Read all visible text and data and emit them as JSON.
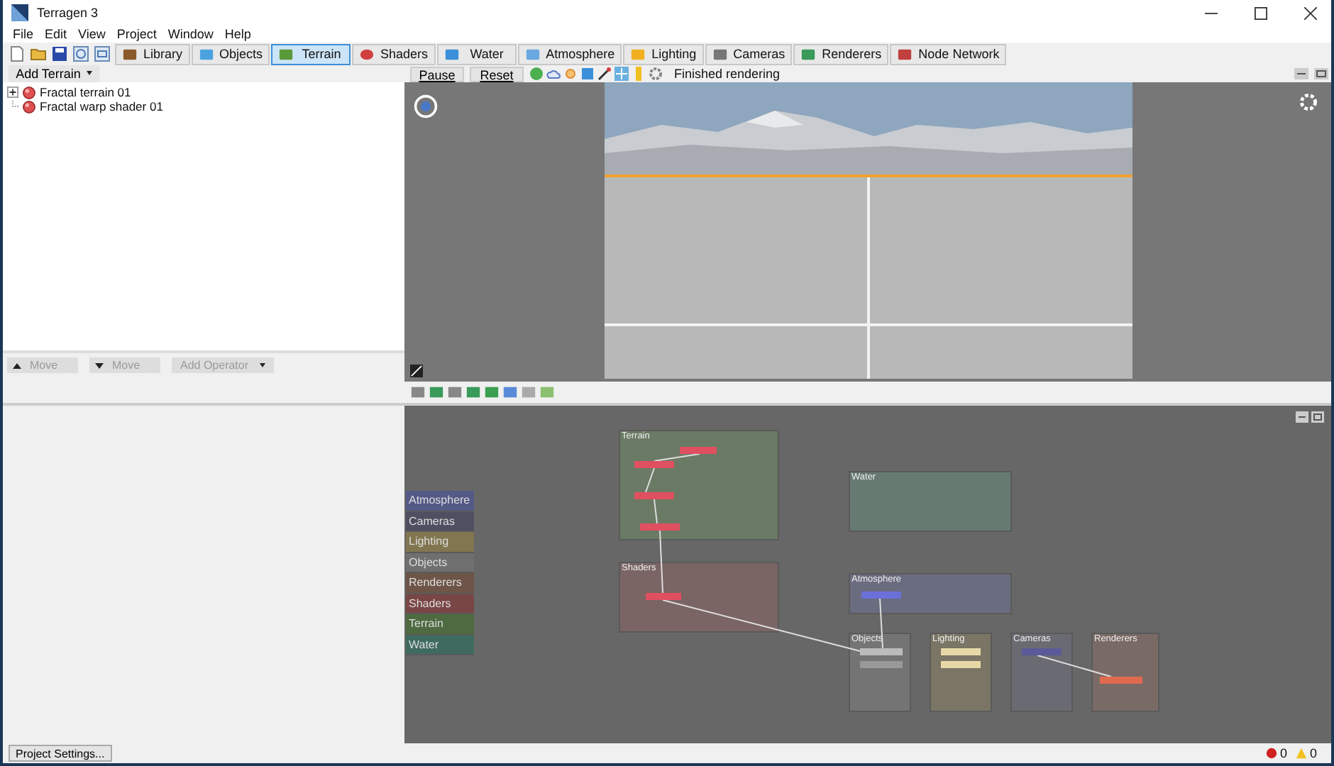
{
  "window": {
    "title": "Terragen 3"
  },
  "menu": [
    "File",
    "Edit",
    "View",
    "Project",
    "Window",
    "Help"
  ],
  "tabs": [
    {
      "label": "Library",
      "selected": false
    },
    {
      "label": "Objects",
      "selected": false
    },
    {
      "label": "Terrain",
      "selected": true
    },
    {
      "label": "Shaders",
      "selected": false
    },
    {
      "label": "Water",
      "selected": false
    },
    {
      "label": "Atmosphere",
      "selected": false
    },
    {
      "label": "Lighting",
      "selected": false
    },
    {
      "label": "Cameras",
      "selected": false
    },
    {
      "label": "Renderers",
      "selected": false
    },
    {
      "label": "Node Network",
      "selected": false
    }
  ],
  "add_button": "Add Terrain",
  "tree": [
    {
      "label": "Fractal terrain 01",
      "kind": "collapsed"
    },
    {
      "label": "Fractal warp shader 01",
      "kind": "leaf"
    }
  ],
  "move_buttons": [
    {
      "label": "Move",
      "disabled": true
    },
    {
      "label": "Move",
      "disabled": true
    }
  ],
  "add_operator": {
    "label": "Add Operator",
    "disabled": true
  },
  "render_controls": {
    "buttons": [
      "Pause",
      "Reset"
    ],
    "status": "Finished rendering"
  },
  "legend": [
    {
      "label": "Atmosphere",
      "color": "#545a86"
    },
    {
      "label": "Cameras",
      "color": "#4f4f62"
    },
    {
      "label": "Lighting",
      "color": "#817650"
    },
    {
      "label": "Objects",
      "color": "#6f6f6f"
    },
    {
      "label": "Renderers",
      "color": "#6e5548"
    },
    {
      "label": "Shaders",
      "color": "#7a4545"
    },
    {
      "label": "Terrain",
      "color": "#4e6a40"
    },
    {
      "label": "Water",
      "color": "#3f6b5f"
    }
  ],
  "groups": [
    {
      "title": "Terrain",
      "color": "#6a7a64"
    },
    {
      "title": "Water",
      "color": "#667a72"
    },
    {
      "title": "Shaders",
      "color": "#7a6464"
    },
    {
      "title": "Atmosphere",
      "color": "#6a6c80"
    },
    {
      "title": "Objects",
      "color": "#747474"
    },
    {
      "title": "Lighting",
      "color": "#7a7564"
    },
    {
      "title": "Cameras",
      "color": "#6a6a72"
    },
    {
      "title": "Renderers",
      "color": "#7a6a66"
    }
  ],
  "status_bar": {
    "button": "Project Settings...",
    "errors": "0",
    "warnings": "0"
  }
}
